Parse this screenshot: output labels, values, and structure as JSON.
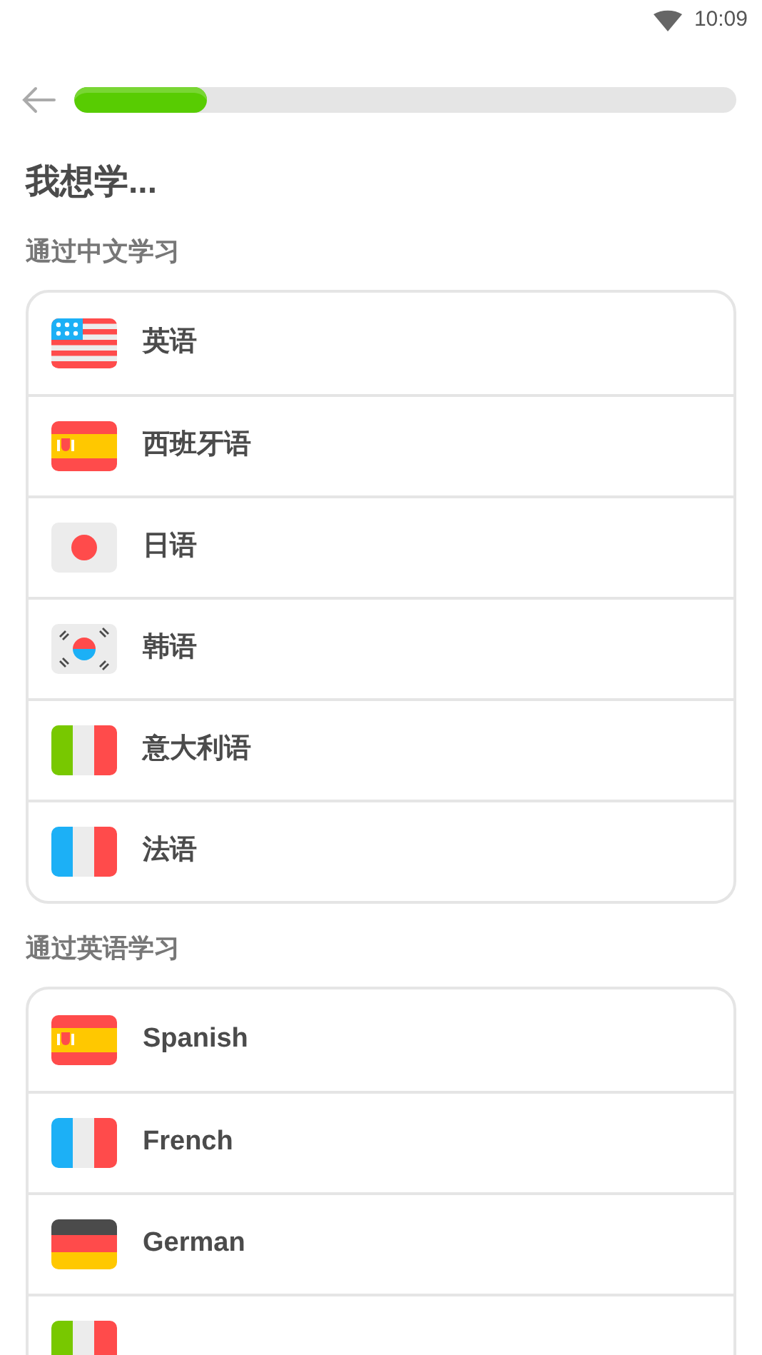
{
  "status_bar": {
    "time": "10:09"
  },
  "progress": {
    "level": 0.2
  },
  "title": "我想学...",
  "sections": [
    {
      "heading": "通过中文学习",
      "items": [
        {
          "kind": "us",
          "label": "英语"
        },
        {
          "kind": "es",
          "label": "西班牙语"
        },
        {
          "kind": "jp",
          "label": "日语"
        },
        {
          "kind": "kr",
          "label": "韩语"
        },
        {
          "kind": "it",
          "label": "意大利语"
        },
        {
          "kind": "fr",
          "label": "法语"
        }
      ]
    },
    {
      "heading": "通过英语学习",
      "items": [
        {
          "kind": "es",
          "label": "Spanish"
        },
        {
          "kind": "fr",
          "label": "French"
        },
        {
          "kind": "de",
          "label": "German"
        },
        {
          "kind": "it"
        }
      ]
    }
  ]
}
